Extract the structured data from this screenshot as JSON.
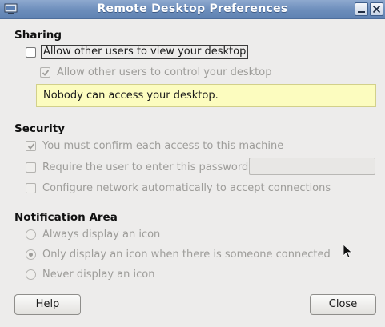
{
  "window": {
    "title": "Remote Desktop Preferences",
    "app_icon": "computer-icon",
    "minimize_icon": "minimize-icon",
    "close_icon": "close-icon"
  },
  "sharing": {
    "heading": "Sharing",
    "allow_view": {
      "label": "Allow other users to view your desktop",
      "checked": false,
      "enabled": true
    },
    "allow_control": {
      "label": "Allow other users to control your desktop",
      "checked": true,
      "enabled": false
    },
    "status_message": "Nobody can access your desktop."
  },
  "security": {
    "heading": "Security",
    "confirm_access": {
      "label": "You must confirm each access to this machine",
      "checked": true,
      "enabled": false
    },
    "require_password": {
      "label": "Require the user to enter this password:",
      "checked": false,
      "enabled": false
    },
    "password_value": "",
    "configure_network": {
      "label": "Configure network automatically to accept connections",
      "checked": false,
      "enabled": false
    }
  },
  "notification": {
    "heading": "Notification Area",
    "options": [
      {
        "label": "Always display an icon",
        "selected": false
      },
      {
        "label": "Only display an icon when there is someone connected",
        "selected": true
      },
      {
        "label": "Never display an icon",
        "selected": false
      }
    ]
  },
  "buttons": {
    "help": "Help",
    "close": "Close"
  },
  "colors": {
    "titlebar": "#6c8dbb",
    "info_background": "#fcfcbf",
    "window_background": "#edeceb"
  }
}
